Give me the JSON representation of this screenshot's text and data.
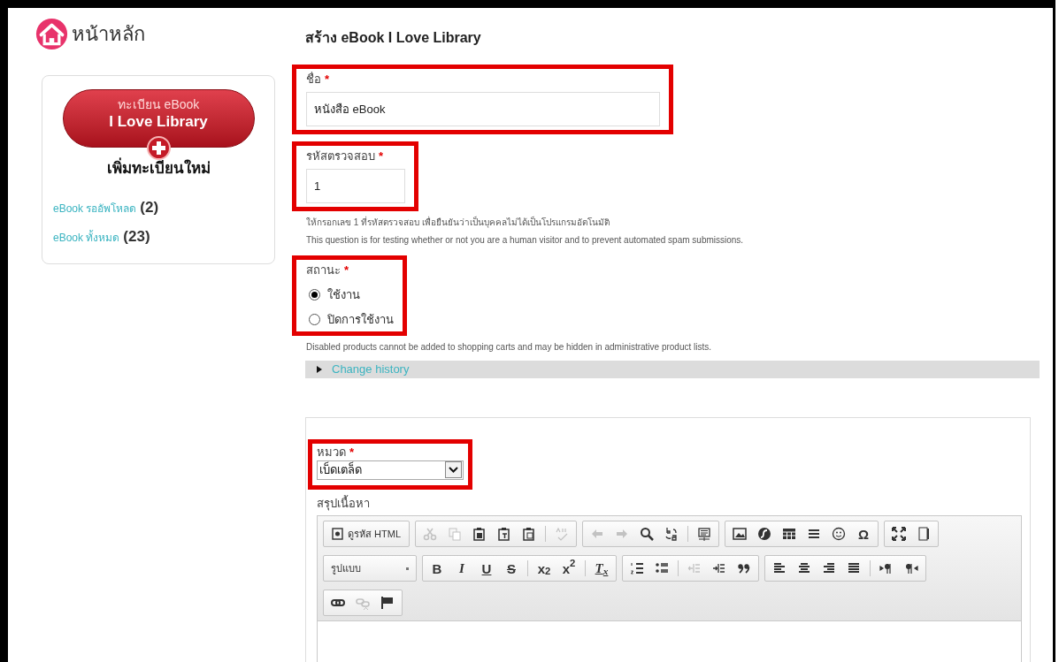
{
  "home": {
    "label": "หน้าหลัก"
  },
  "sidebar": {
    "register_button": {
      "line_1": "ทะเบียน eBook",
      "line_2": "I Love Library"
    },
    "add_label": "เพิ่มทะเบียนใหม่",
    "links": [
      {
        "label": "eBook รออัพโหลด",
        "count": "(2)"
      },
      {
        "label": "eBook ทั้งหมด",
        "count": "(23)"
      }
    ]
  },
  "page_title": "สร้าง eBook I Love Library",
  "fields": [
    {
      "kind": "text",
      "label": "ชื่อ",
      "required_mark": "*",
      "value": "หนังสือ eBook",
      "highlighted": true
    },
    {
      "kind": "text",
      "label": "รหัสตรวจสอบ",
      "required_mark": "*",
      "value": "1",
      "highlighted": true,
      "help": [
        "ให้กรอกเลข 1 ที่รหัสตรวจสอบ เพื่อยืนยันว่าเป็นบุคคลไม่ได้เป็นโปรแกรมอัตโนมัติ",
        "This question is for testing whether or not you are a human visitor and to prevent automated spam submissions."
      ]
    },
    {
      "kind": "radio",
      "label": "สถานะ",
      "required_mark": "*",
      "highlighted": true,
      "options": [
        {
          "label": "ใช้งาน",
          "selected": true
        },
        {
          "label": "ปิดการใช้งาน",
          "selected": false
        }
      ],
      "help": [
        "Disabled products cannot be added to shopping carts and may be hidden in administrative product lists."
      ]
    }
  ],
  "change_history": {
    "label": "Change history",
    "expanded": false
  },
  "category": {
    "label": "หมวด",
    "required_mark": "*",
    "value": "เบ็ดเตล็ด",
    "highlighted": true
  },
  "editor": {
    "label": "สรุปเนื้อหา",
    "toolbar": [
      [
        {
          "items": [
            {
              "kind": "source",
              "label": "ดูรหัส HTML",
              "disabled": false
            }
          ]
        },
        {
          "items": [
            {
              "kind": "cut",
              "disabled": true
            },
            {
              "kind": "copy",
              "disabled": true
            },
            {
              "kind": "paste",
              "disabled": false
            },
            {
              "kind": "paste-text",
              "disabled": false
            },
            {
              "kind": "paste-word",
              "disabled": false
            },
            {
              "kind": "separator"
            },
            {
              "kind": "spellcheck",
              "disabled": true
            }
          ]
        },
        {
          "items": [
            {
              "kind": "undo",
              "disabled": true
            },
            {
              "kind": "redo",
              "disabled": true
            },
            {
              "kind": "find",
              "disabled": false
            },
            {
              "kind": "replace",
              "disabled": false
            },
            {
              "kind": "separator"
            },
            {
              "kind": "select-all",
              "disabled": false
            }
          ]
        },
        {
          "items": [
            {
              "kind": "image",
              "disabled": false
            },
            {
              "kind": "flash",
              "disabled": false
            },
            {
              "kind": "table",
              "disabled": false
            },
            {
              "kind": "rule",
              "disabled": false
            },
            {
              "kind": "smiley",
              "disabled": false
            },
            {
              "kind": "glyph",
              "text": "Ω",
              "disabled": false
            }
          ]
        },
        {
          "items": [
            {
              "kind": "maximize",
              "disabled": false
            },
            {
              "kind": "blocks",
              "disabled": false
            }
          ]
        }
      ],
      [
        {
          "items": [
            {
              "kind": "format",
              "label": "รูปแบบ",
              "disabled": false
            }
          ]
        },
        {
          "items": [
            {
              "kind": "bold",
              "text": "B",
              "disabled": false
            },
            {
              "kind": "italic",
              "text": "I",
              "disabled": false
            },
            {
              "kind": "underline",
              "text": "U",
              "disabled": false
            },
            {
              "kind": "strike",
              "text": "S",
              "disabled": false
            },
            {
              "kind": "separator"
            },
            {
              "kind": "glyph",
              "text": "x$_{2}$",
              "disabled": false
            },
            {
              "kind": "glyph",
              "text": "x$^{2}$",
              "disabled": false
            },
            {
              "kind": "separator"
            },
            {
              "kind": "remove-format",
              "text": "T$_{x}$",
              "disabled": false
            }
          ]
        },
        {
          "items": [
            {
              "kind": "numbered-list",
              "disabled": false
            },
            {
              "kind": "bullet-list",
              "disabled": false
            },
            {
              "kind": "separator"
            },
            {
              "kind": "outdent",
              "disabled": true
            },
            {
              "kind": "indent",
              "disabled": false
            },
            {
              "kind": "quote",
              "disabled": false
            }
          ]
        },
        {
          "items": [
            {
              "kind": "align-left",
              "disabled": false
            },
            {
              "kind": "align-center",
              "disabled": false
            },
            {
              "kind": "align-right",
              "disabled": false
            },
            {
              "kind": "justify",
              "disabled": false
            },
            {
              "kind": "separator"
            },
            {
              "kind": "ltr",
              "disabled": false
            },
            {
              "kind": "rtl",
              "disabled": false
            }
          ]
        }
      ],
      [
        {
          "items": [
            {
              "kind": "link",
              "disabled": false
            },
            {
              "kind": "unlink",
              "disabled": true
            },
            {
              "kind": "anchor",
              "disabled": false
            }
          ]
        }
      ]
    ]
  }
}
